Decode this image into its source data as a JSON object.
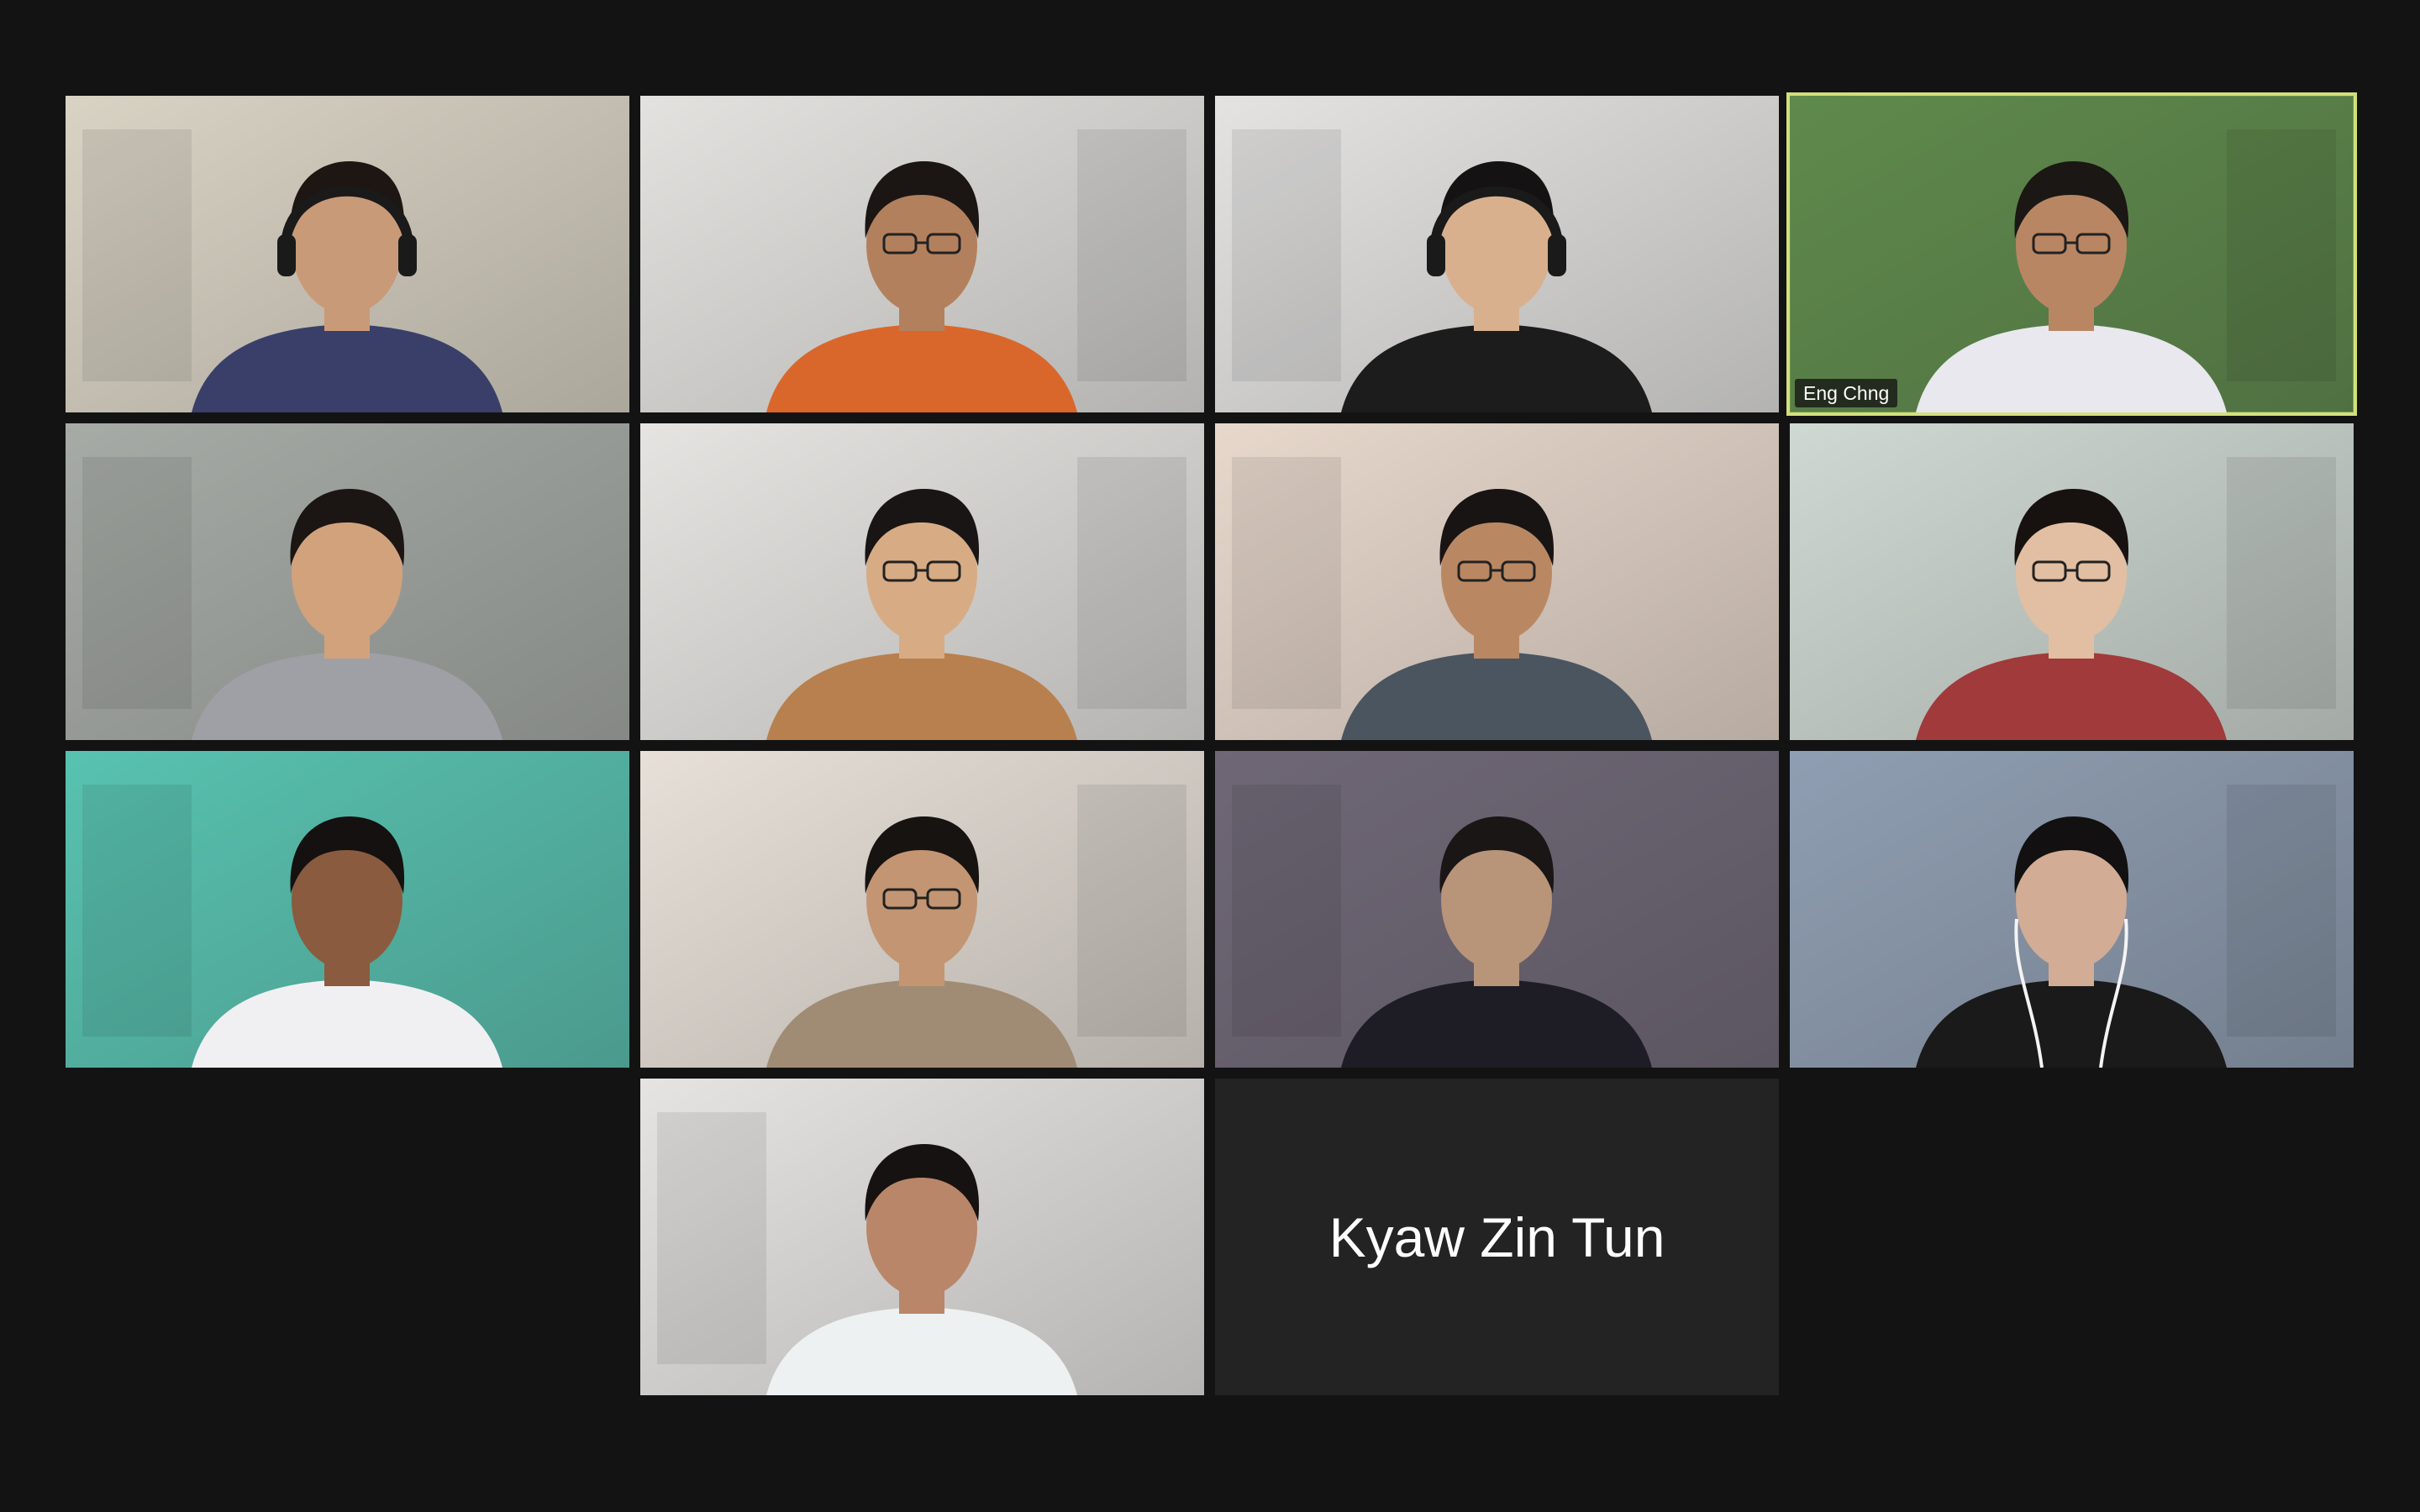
{
  "meeting": {
    "view": "gallery",
    "accent_color": "#d3e07a",
    "background_color": "#131313",
    "participants": [
      {
        "label": "",
        "video": "on",
        "skin": "#c99a78",
        "hair": "#1d1612",
        "shirt": "#3a3f6a",
        "backdrop": "#d9d3c4",
        "accessory": "headset"
      },
      {
        "label": "",
        "video": "on",
        "skin": "#b3805e",
        "hair": "#1b1614",
        "shirt": "#d9672c",
        "backdrop": "#e3e2df",
        "accessory": "glasses"
      },
      {
        "label": "",
        "video": "on",
        "skin": "#d9b08d",
        "hair": "#141212",
        "shirt": "#1c1c1c",
        "backdrop": "#e4e3e2",
        "accessory": "headset"
      },
      {
        "label": "Eng Chng",
        "video": "on",
        "active_speaker": true,
        "skin": "#b98663",
        "hair": "#1b1714",
        "shirt": "#e8e8ee",
        "backdrop": "#5f8a4c",
        "accessory": "glasses"
      },
      {
        "label": "",
        "video": "on",
        "skin": "#d2a27c",
        "hair": "#1b1614",
        "shirt": "#9fa0a6",
        "backdrop": "#a6aba6",
        "accessory": "none"
      },
      {
        "label": "",
        "video": "on",
        "skin": "#d7ac84",
        "hair": "#191514",
        "shirt": "#b8804e",
        "backdrop": "#e6e4e1",
        "accessory": "glasses"
      },
      {
        "label": "",
        "video": "on",
        "skin": "#b98863",
        "hair": "#181414",
        "shirt": "#4a5560",
        "backdrop": "#e8d8cc",
        "accessory": "glasses"
      },
      {
        "label": "",
        "video": "on",
        "skin": "#e2bfa2",
        "hair": "#17120f",
        "shirt": "#a13a3a",
        "backdrop": "#cfd8d2",
        "accessory": "glasses"
      },
      {
        "label": "",
        "video": "on",
        "skin": "#8a5b3f",
        "hair": "#141110",
        "shirt": "#f0f0f2",
        "backdrop": "#58c2b0",
        "accessory": "none"
      },
      {
        "label": "",
        "video": "on",
        "skin": "#c49572",
        "hair": "#171311",
        "shirt": "#a08c74",
        "backdrop": "#e7e0d8",
        "accessory": "glasses"
      },
      {
        "label": "",
        "video": "on",
        "skin": "#b89479",
        "hair": "#1a1615",
        "shirt": "#1e1c24",
        "backdrop": "#6f6776",
        "accessory": "none"
      },
      {
        "label": "",
        "video": "on",
        "skin": "#d2ac94",
        "hair": "#121010",
        "shirt": "#1a1a1a",
        "backdrop": "#8f9eb2",
        "accessory": "earphones"
      },
      {
        "label": "",
        "video": "on",
        "skin": "#b9866a",
        "hair": "#161211",
        "shirt": "#edf1f2",
        "backdrop": "#e6e4e2",
        "accessory": "none"
      },
      {
        "label": "Kyaw Zin Tun",
        "video": "off",
        "active_speaker": false
      }
    ]
  }
}
